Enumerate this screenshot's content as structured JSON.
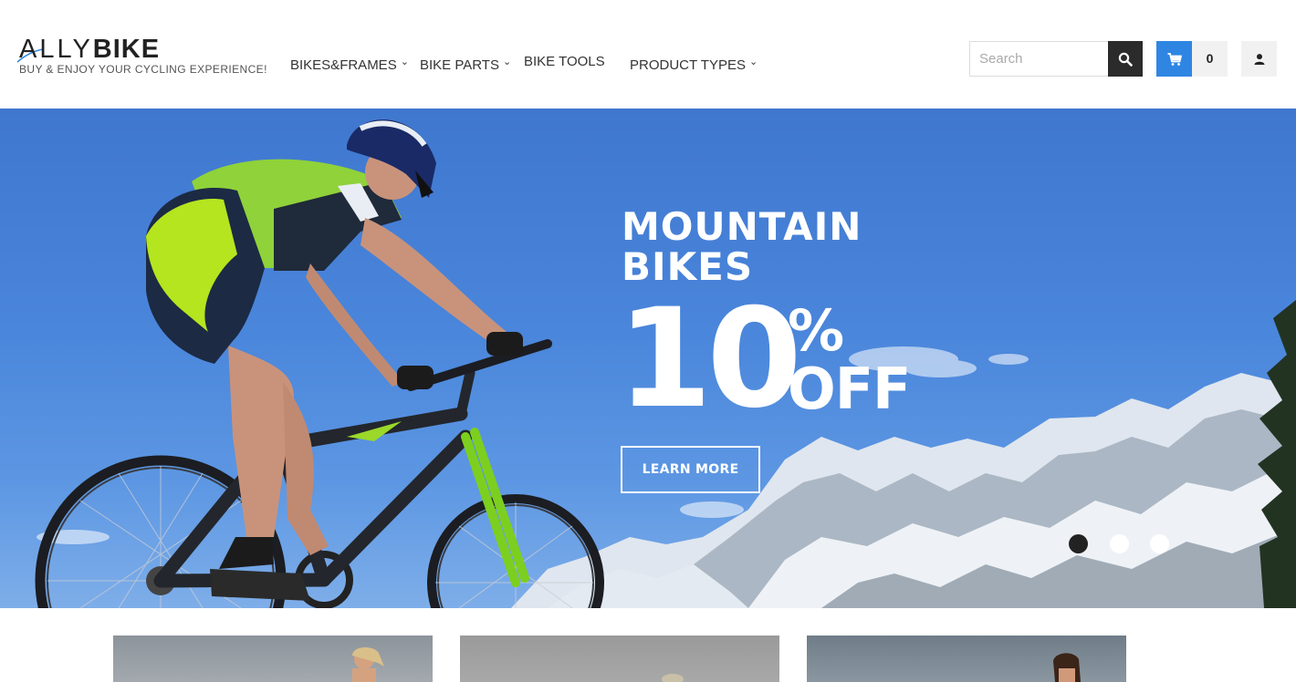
{
  "header": {
    "logo": {
      "part_light": "ALLY",
      "part_bold": "BIKE",
      "tagline": "BUY & ENJOY YOUR CYCLING EXPERIENCE!"
    },
    "nav": [
      {
        "label": "BIKES&FRAMES",
        "has_dropdown": true
      },
      {
        "label": "BIKE PARTS",
        "has_dropdown": true
      },
      {
        "label": "BIKE TOOLS",
        "has_dropdown": false
      },
      {
        "label": "PRODUCT TYPES",
        "has_dropdown": true
      }
    ],
    "search": {
      "placeholder": "Search",
      "button_icon": "search-icon"
    },
    "cart": {
      "icon": "cart-icon",
      "count": "0",
      "color": "#2f86e2"
    },
    "account": {
      "icon": "user-icon"
    }
  },
  "hero": {
    "title_line1": "MOUNTAIN",
    "title_line2": "BIKES",
    "discount_number": "10",
    "discount_percent": "%",
    "discount_off": "OFF",
    "cta_label": "LEARN MORE",
    "slides": {
      "count": 3,
      "active_index": 0
    }
  },
  "colors": {
    "accent": "#2f86e2",
    "dark": "#2b2b2b",
    "sky": "#4a86db"
  }
}
